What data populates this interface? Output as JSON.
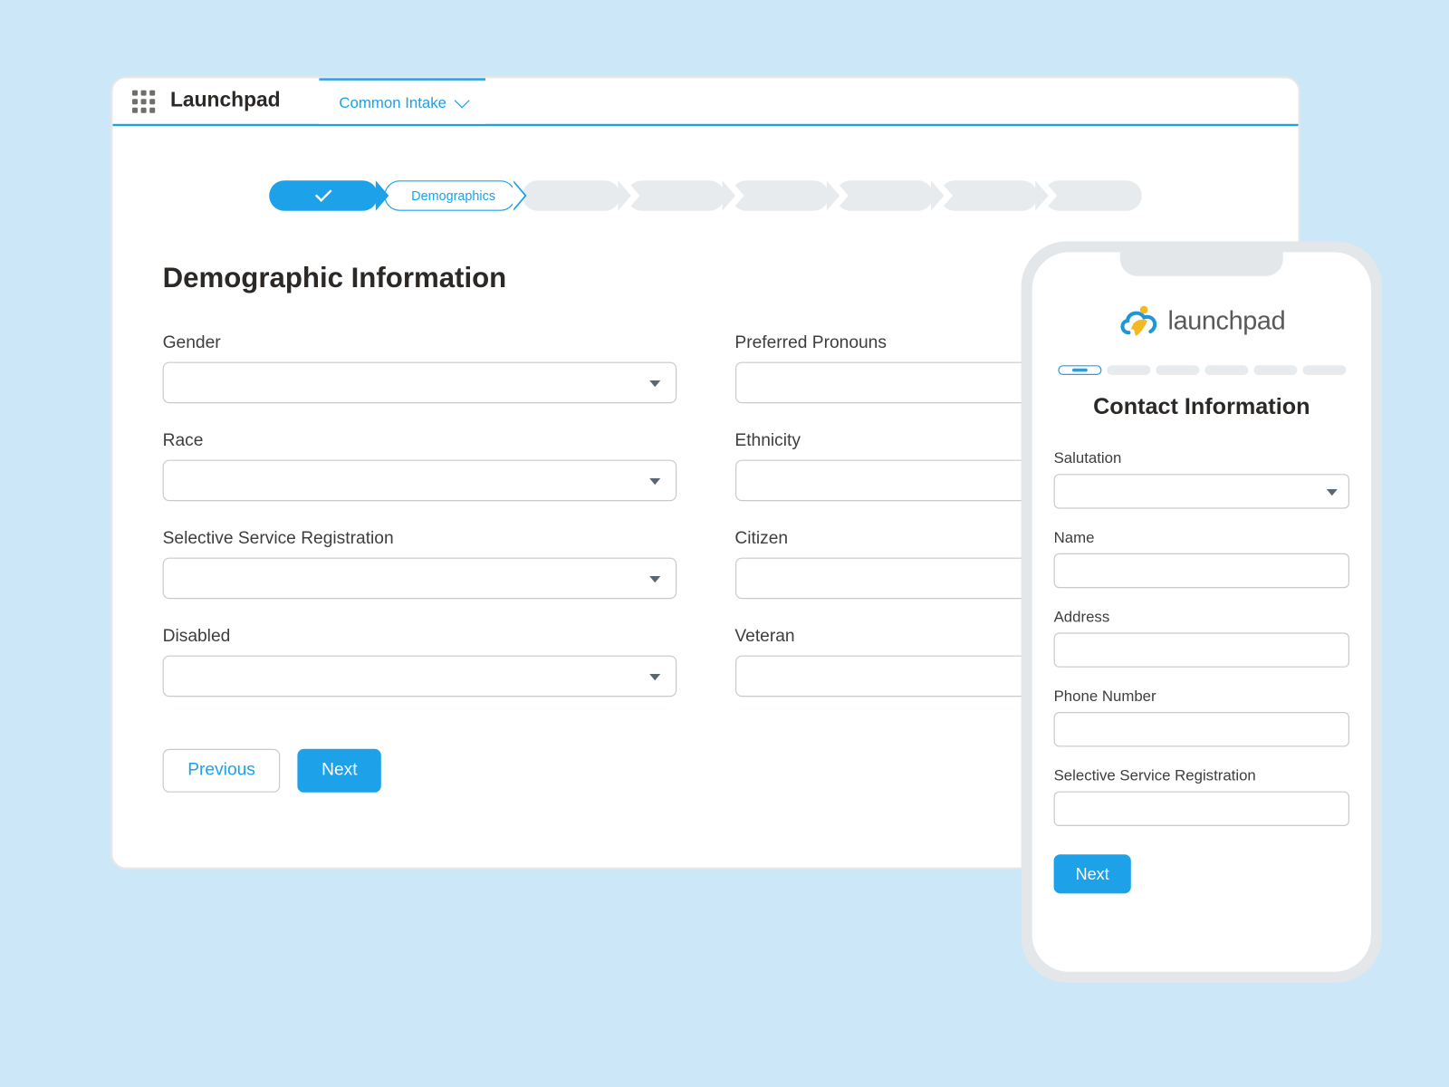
{
  "header": {
    "app_title": "Launchpad",
    "tab_label": "Common Intake"
  },
  "breadcrumbs": {
    "completed": 1,
    "current_label": "Demographics",
    "future_count": 6
  },
  "desktop": {
    "section_title": "Demographic Information",
    "fields": {
      "gender": "Gender",
      "pronouns": "Preferred Pronouns",
      "race": "Race",
      "ethnicity": "Ethnicity",
      "ssr": "Selective Service Registration",
      "citizen": "Citizen",
      "disabled": "Disabled",
      "veteran": "Veteran"
    },
    "buttons": {
      "previous": "Previous",
      "next": "Next"
    }
  },
  "mobile": {
    "brand": "launchpad",
    "title": "Contact Information",
    "progress_step_label": "1",
    "fields": {
      "salutation": "Salutation",
      "name": "Name",
      "address": "Address",
      "phone": "Phone Number",
      "ssr": "Selective Service Registration"
    },
    "next": "Next"
  },
  "colors": {
    "accent": "#1da1e8",
    "page_bg": "#cce7f7",
    "gray_fill": "#e8ebee",
    "border": "#c6cbce",
    "logo_yellow": "#f3b822",
    "logo_blue": "#1f97d4"
  }
}
